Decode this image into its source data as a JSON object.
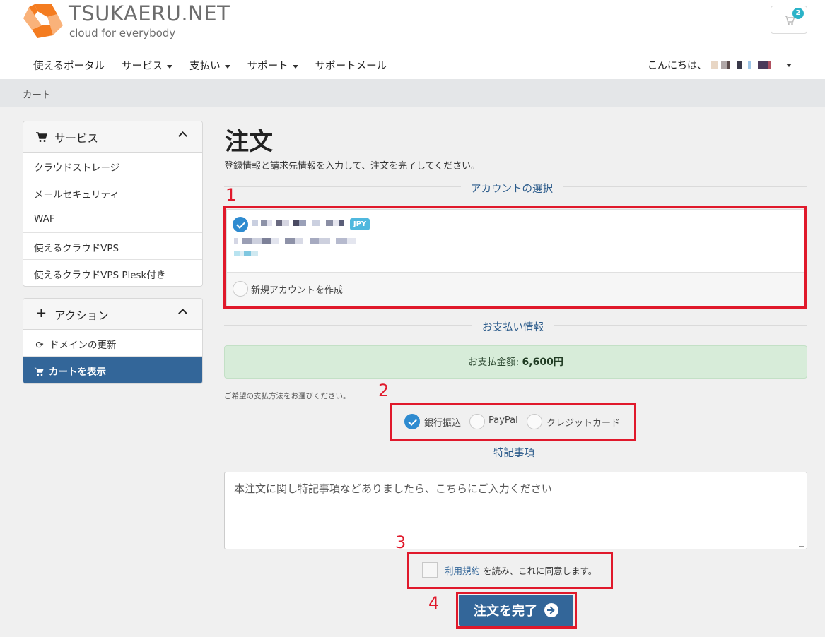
{
  "brand": {
    "title": "TSUKAERU.NET",
    "subtitle": "cloud for everybody",
    "colors": [
      "#f47c20",
      "#f9b27a"
    ]
  },
  "cart": {
    "count": "2",
    "icon": "cart-icon"
  },
  "nav": {
    "items": [
      {
        "label": "使えるポータル",
        "dropdown": false
      },
      {
        "label": "サービス",
        "dropdown": true
      },
      {
        "label": "支払い",
        "dropdown": true
      },
      {
        "label": "サポート",
        "dropdown": true
      },
      {
        "label": "サポートメール",
        "dropdown": false
      }
    ],
    "greeting": "こんにちは、"
  },
  "breadcrumb": "カート",
  "sidebar": {
    "services": {
      "title": "サービス",
      "icon": "cart-icon",
      "items": [
        "クラウドストレージ",
        "メールセキュリティ",
        "WAF",
        "使えるクラウドVPS",
        "使えるクラウドVPS Plesk付き"
      ]
    },
    "actions": {
      "title": "アクション",
      "icon": "plus-icon",
      "items": [
        {
          "label": "ドメインの更新",
          "icon": "refresh-icon",
          "active": false
        },
        {
          "label": "カートを表示",
          "icon": "cart-icon",
          "active": true
        }
      ]
    }
  },
  "main": {
    "title": "注文",
    "subtitle": "登録情報と請求先情報を入力して、注文を完了してください。",
    "account_section": "アカウントの選択",
    "account": {
      "currency_badge": "JPY",
      "new_account_label": "新規アカウントを作成"
    },
    "payment_section": "お支払い情報",
    "amount_label": "お支払金額:",
    "amount_value": "6,600円",
    "payment_hint": "ご希望の支払方法をお選びください。",
    "payment_methods": [
      {
        "label": "銀行振込",
        "selected": true
      },
      {
        "label": "PayPal",
        "selected": false
      },
      {
        "label": "クレジットカード",
        "selected": false
      }
    ],
    "notes_section": "特記事項",
    "notes_placeholder": "本注文に関し特記事項などありましたら、こちらにご入力ください",
    "terms_link": "利用規約",
    "terms_text": "を読み、これに同意します。",
    "submit_label": "注文を完了"
  },
  "annotations": [
    "1",
    "2",
    "3",
    "4"
  ],
  "colors": {
    "accent": "#336699",
    "annotation": "#e0192b",
    "success_bg": "#d7ecd9",
    "badge": "#4fb8de"
  }
}
